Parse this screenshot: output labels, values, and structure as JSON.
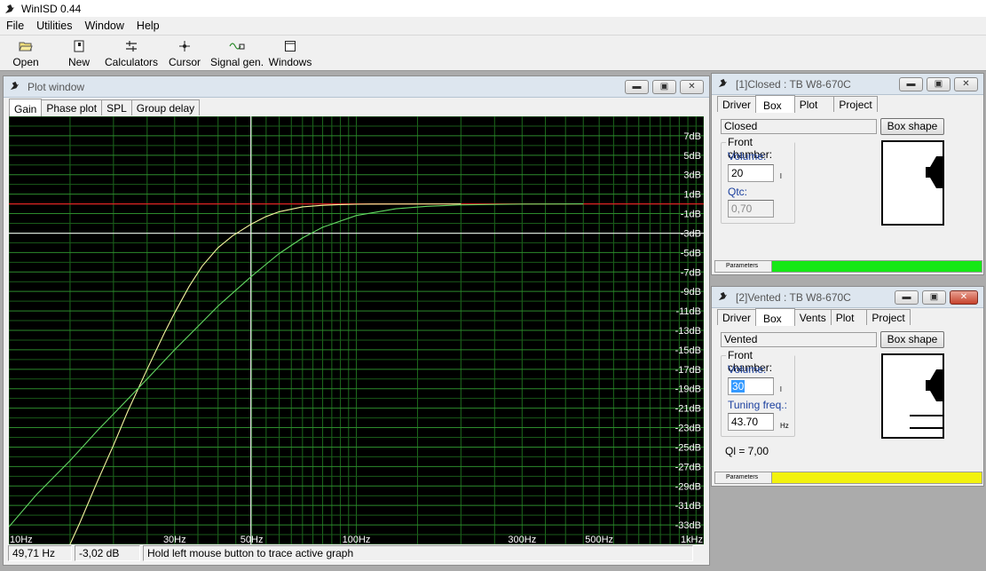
{
  "app": {
    "title": "WinISD 0.44"
  },
  "menu": [
    "File",
    "Utilities",
    "Window",
    "Help"
  ],
  "toolbar": [
    {
      "label": "Open",
      "icon": "open-folder-icon"
    },
    {
      "label": "New",
      "icon": "new-document-icon"
    },
    {
      "label": "Calculators",
      "icon": "calculator-icon"
    },
    {
      "label": "Cursor",
      "icon": "cursor-icon"
    },
    {
      "label": "Signal gen.",
      "icon": "signal-generator-icon"
    },
    {
      "label": "Windows",
      "icon": "windows-icon"
    }
  ],
  "plot_window": {
    "title": "Plot window",
    "tabs": [
      "Gain",
      "Phase plot",
      "SPL",
      "Group delay"
    ],
    "active_tab": "Gain",
    "status": {
      "frequency": "49,71 Hz",
      "level": "-3,02 dB",
      "hint": "Hold left mouse button to trace active graph"
    }
  },
  "chart_data": {
    "type": "line",
    "x_scale": "log",
    "xlim": [
      10,
      1000
    ],
    "ylim": [
      -35,
      9
    ],
    "x_tick_labels": [
      {
        "value": 10,
        "label": "10Hz"
      },
      {
        "value": 30,
        "label": "30Hz"
      },
      {
        "value": 50,
        "label": "50Hz"
      },
      {
        "value": 100,
        "label": "100Hz"
      },
      {
        "value": 300,
        "label": "300Hz"
      },
      {
        "value": 500,
        "label": "500Hz"
      },
      {
        "value": 1000,
        "label": "1kHz"
      }
    ],
    "y_tick_labels": [
      {
        "value": 7,
        "label": "7dB"
      },
      {
        "value": 5,
        "label": "5dB"
      },
      {
        "value": 3,
        "label": "3dB"
      },
      {
        "value": 1,
        "label": "1dB"
      },
      {
        "value": -1,
        "label": "-1dB"
      },
      {
        "value": -3,
        "label": "-3dB"
      },
      {
        "value": -5,
        "label": "-5dB"
      },
      {
        "value": -7,
        "label": "-7dB"
      },
      {
        "value": -9,
        "label": "-9dB"
      },
      {
        "value": -11,
        "label": "-11dB"
      },
      {
        "value": -13,
        "label": "-13dB"
      },
      {
        "value": -15,
        "label": "-15dB"
      },
      {
        "value": -17,
        "label": "-17dB"
      },
      {
        "value": -19,
        "label": "-19dB"
      },
      {
        "value": -21,
        "label": "-21dB"
      },
      {
        "value": -23,
        "label": "-23dB"
      },
      {
        "value": -25,
        "label": "-25dB"
      },
      {
        "value": -27,
        "label": "-27dB"
      },
      {
        "value": -29,
        "label": "-29dB"
      },
      {
        "value": -31,
        "label": "-31dB"
      },
      {
        "value": -33,
        "label": "-33dB"
      }
    ],
    "grid": true,
    "cursor": {
      "x": 49.71,
      "y": -3.02
    },
    "reference_line": 0,
    "series": [
      {
        "color": "#f6f6a0",
        "x": [
          15,
          16,
          18,
          20,
          22,
          25,
          28,
          30,
          33,
          36,
          40,
          44,
          49.7,
          55,
          60,
          70,
          80,
          90,
          100,
          110,
          200
        ],
        "y": [
          -35,
          -32.8,
          -28.5,
          -24.8,
          -21.3,
          -17.0,
          -13.3,
          -11.2,
          -8.5,
          -6.4,
          -4.5,
          -3.3,
          -2.1,
          -1.3,
          -0.8,
          -0.3,
          -0.15,
          -0.07,
          -0.04,
          -0.02,
          0
        ]
      },
      {
        "color": "#63d863",
        "x": [
          10,
          12,
          15,
          18,
          20,
          25,
          30,
          35,
          40,
          49.7,
          55,
          60,
          70,
          80,
          100,
          130,
          160,
          200,
          300,
          450
        ],
        "y": [
          -33.2,
          -29.9,
          -26.4,
          -23.3,
          -21.6,
          -18.0,
          -15.0,
          -12.6,
          -10.5,
          -7.5,
          -6.2,
          -5.1,
          -3.5,
          -2.4,
          -1.2,
          -0.5,
          -0.25,
          -0.1,
          -0.02,
          0
        ]
      }
    ]
  },
  "closed_window": {
    "title": "[1]Closed : TB W8-670C",
    "tabs": [
      "Driver",
      "Box",
      "Plot",
      "Project"
    ],
    "active_tab": "Box",
    "box_type": "Closed",
    "box_shape_button": "Box shape",
    "front_chamber": "Front chamber:",
    "volume_label": "Volume:",
    "volume_value": "20",
    "volume_unit": "l",
    "qtc_label": "Qtc:",
    "qtc_value": "0,70",
    "params_label": "Parameters",
    "indicator_color": "#16e816"
  },
  "vented_window": {
    "title": "[2]Vented : TB W8-670C",
    "tabs": [
      "Driver",
      "Box",
      "Vents",
      "Plot",
      "Project"
    ],
    "active_tab": "Box",
    "box_type": "Vented",
    "box_shape_button": "Box shape",
    "front_chamber": "Front chamber:",
    "volume_label": "Volume:",
    "volume_value": "30",
    "volume_unit": "l",
    "tuning_label": "Tuning freq.:",
    "tuning_value": "43.70",
    "tuning_unit": "Hz",
    "ql_text": "Ql = 7,00",
    "params_label": "Parameters",
    "indicator_color": "#f2f20e"
  }
}
